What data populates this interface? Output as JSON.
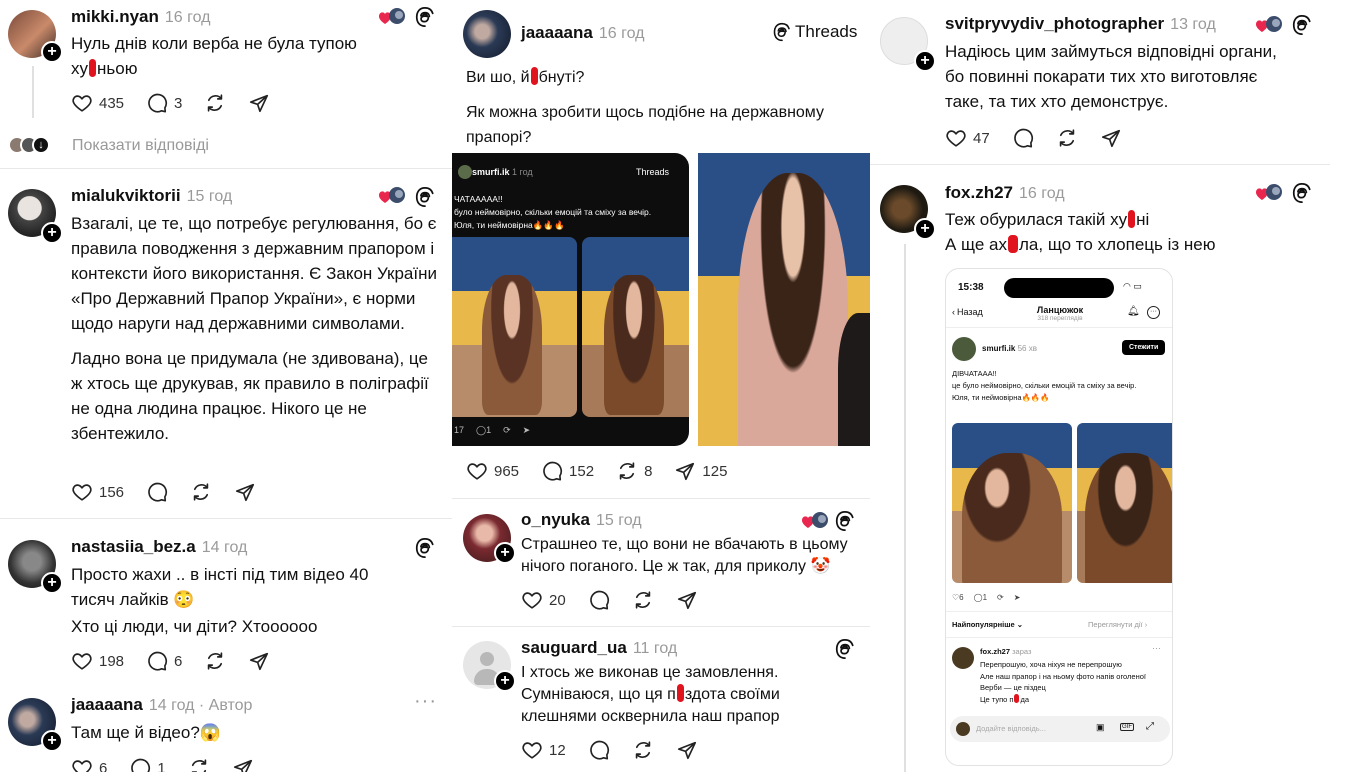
{
  "col1": {
    "posts": [
      {
        "user": "mikki.nyan",
        "time": "16 год",
        "line1": "Нуль днів коли верба не була тупою",
        "line2a": "ху",
        "line2b": "ньою",
        "likes": "435",
        "comments": "3"
      },
      {
        "user": "mialukviktorii",
        "time": "15 год",
        "para1": "Взагалі, це те, що потребує регулювання, бо є правила поводження з державним прапором і контексти його використання. Є Закон України «Про Державний Прапор України», є норми щодо наруги над державними символами.",
        "para2": "Ладно вона це придумала (не здивована), це ж хтось ще друкував, як правило в поліграфії не одна людина працює. Нікого це не збентежило.",
        "likes": "156"
      },
      {
        "user": "nastasiia_bez.a",
        "time": "14 год",
        "para1": "Просто жахи .. в інсті під тим відео 40 тисяч лайків 😳",
        "para2": "Хто ці люди, чи діти? Хтоооооо",
        "likes": "198",
        "comments": "6"
      },
      {
        "user": "jaaaaana",
        "time": "14 год · Автор",
        "text": "Там ще й відео?😱",
        "likes": "6",
        "comments": "1"
      }
    ],
    "show_replies": "Показати відповіді"
  },
  "col2": {
    "header": {
      "user": "jaaaaana",
      "time": "16 год",
      "brand": "Threads"
    },
    "text1a": "Ви шо, й",
    "text1b": "бнуті?",
    "text2": "Як можна зробити щось подібне на державному прапорі?",
    "embed": {
      "user": "smurfi.ik",
      "time": "1 год",
      "brand": "Threads",
      "l1": "ЧАТААААА!!",
      "l2": "було неймовірно, скільки емоцій та сміху за вечір.",
      "l3": "Юля, ти неймовірна🔥🔥🔥",
      "c1": "17",
      "c2": "1"
    },
    "main_likes": "965",
    "main_comments": "152",
    "main_reposts": "8",
    "main_shares": "125",
    "replies": [
      {
        "user": "o_nyuka",
        "time": "15 год",
        "text": "Страшнео те, що вони не вбачають в цьому нічого поганого. Це ж так, для приколу 🤡",
        "likes": "20"
      },
      {
        "user": "sauguard_ua",
        "time": "11 год",
        "l1": "І хтось же виконав це замовлення.",
        "l2a": "Сумніваюся, що ця п",
        "l2b": "здота своїми",
        "l3": "клешнями осквернила наш прапор",
        "likes": "12"
      }
    ]
  },
  "col3": {
    "posts": [
      {
        "user": "svitpryvydiv_photographer",
        "time": "13 год",
        "text": "Надіюсь цим займуться відповідні органи, бо повинні покарати тих хто виготовляє таке, та тих хто демонструє.",
        "likes": "47"
      },
      {
        "user": "fox.zh27",
        "time": "16 год",
        "l1a": "Теж обурилася такій ху",
        "l1b": "ні",
        "l2a": "А ще ах",
        "l2b": "ла, що то хлопець із нею"
      }
    ],
    "phone": {
      "clock": "15:38",
      "back": "Назад",
      "title": "Ланцюжок",
      "subtitle": "318 переглядів",
      "author": "smurfi.ik",
      "author_time": "56 хв",
      "follow": "Стежити",
      "t1": "ДІВЧАТААА!!",
      "t2": "це було неймовірно, скільки емоцій та сміху за вечір.",
      "t3": "Юля, ти неймовірна🔥🔥🔥",
      "c1": "6",
      "c2": "1",
      "sort": "Найпопулярніше",
      "activity": "Переглянути дії",
      "reply_user": "fox.zh27",
      "reply_time": "зараз",
      "r1": "Перепрошую, хоча ніхуя не перепрошую",
      "r2": "Але наш прапор і на ньому фото напів оголеної Верби — це піздец",
      "r3a": "Це тупо п",
      "r3b": "да",
      "input": "Додайте відповідь..."
    }
  },
  "colors": {
    "accent_red": "#e0141e",
    "flag_blue": "#2a4f86",
    "flag_yellow": "#e8b84a"
  }
}
